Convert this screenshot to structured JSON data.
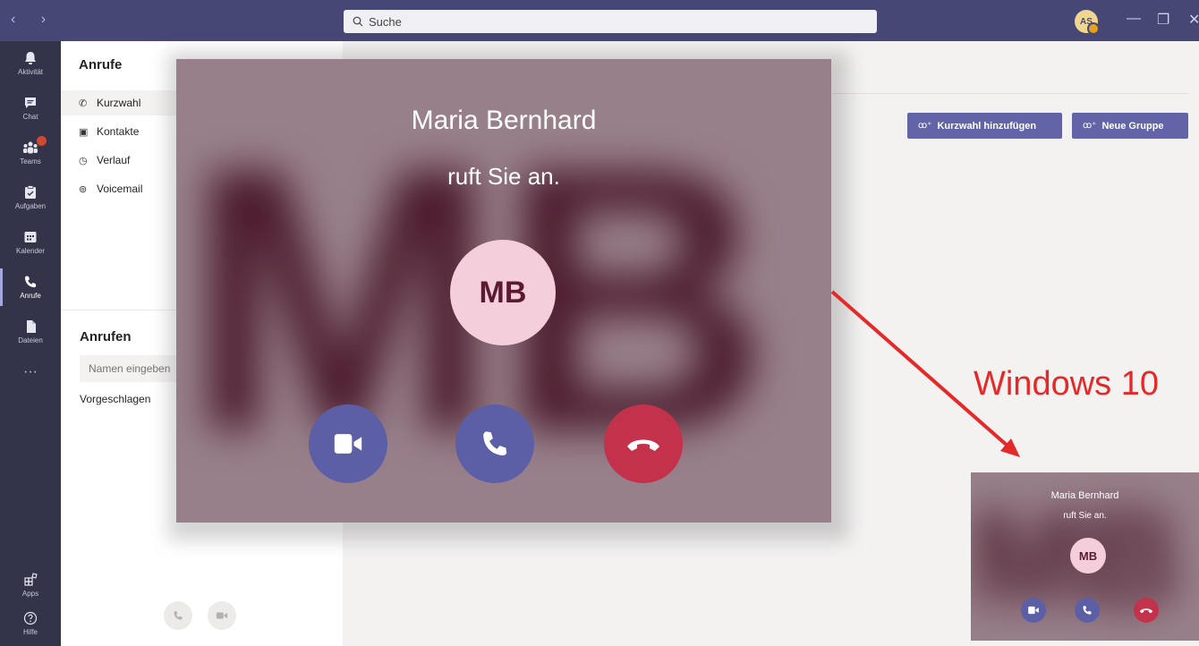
{
  "titlebar": {
    "search_placeholder": "Suche",
    "user_initials": "AS",
    "minimize": "—",
    "restore": "❐",
    "close": "✕"
  },
  "rail": {
    "items": [
      {
        "label": "Aktivität",
        "icon": "bell-icon"
      },
      {
        "label": "Chat",
        "icon": "chat-icon"
      },
      {
        "label": "Teams",
        "icon": "teams-icon"
      },
      {
        "label": "Aufgaben",
        "icon": "tasks-icon"
      },
      {
        "label": "Kalender",
        "icon": "calendar-icon"
      },
      {
        "label": "Anrufe",
        "icon": "phone-icon"
      },
      {
        "label": "Dateien",
        "icon": "file-icon"
      }
    ],
    "more": "···",
    "apps_label": "Apps",
    "help_label": "Hilfe"
  },
  "calls_panel": {
    "title": "Anrufe",
    "nav": [
      {
        "label": "Kurzwahl",
        "icon": "phone-icon"
      },
      {
        "label": "Kontakte",
        "icon": "contacts-icon"
      },
      {
        "label": "Verlauf",
        "icon": "history-icon"
      },
      {
        "label": "Voicemail",
        "icon": "voicemail-icon"
      }
    ],
    "dial_title": "Anrufen",
    "name_placeholder": "Namen eingeben",
    "suggested": "Vorgeschlagen"
  },
  "main": {
    "add_speed_dial": "Kurzwahl hinzufügen",
    "new_group": "Neue Gruppe"
  },
  "incoming_call": {
    "caller_name": "Maria Bernhard",
    "caller_status": "ruft Sie an.",
    "initials": "MB",
    "background_letters": "MB"
  },
  "annotation": {
    "label": "Windows 10",
    "arrow_color": "#e52828"
  }
}
